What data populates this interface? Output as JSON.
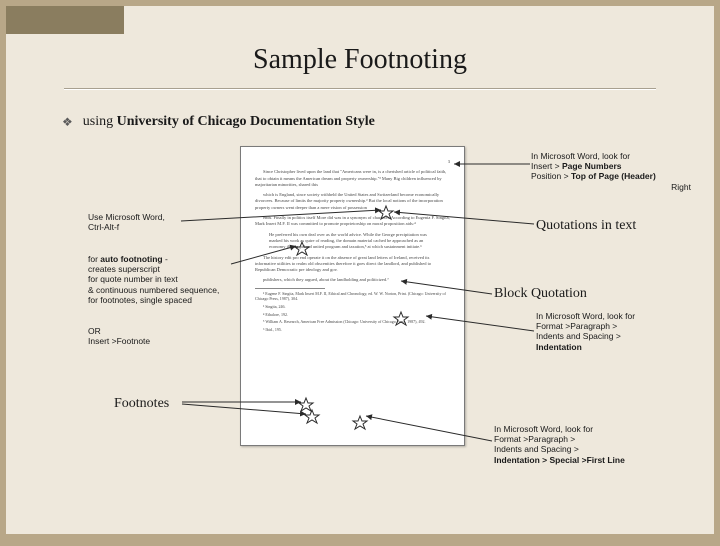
{
  "title": "Sample Footnoting",
  "bullet": {
    "prefix": "using ",
    "style": "University of Chicago Documentation Style"
  },
  "notes": {
    "pgnum": {
      "l1": "In Microsoft Word, look for",
      "l2": "Insert > ",
      "l2b": "Page Numbers",
      "l3": "Position > ",
      "l3b": "Top of Page (Header)",
      "l4": "Right"
    },
    "auto1": {
      "l1": "Use Microsoft Word,",
      "l2": "Ctrl-Alt-f"
    },
    "auto2": {
      "l1": "for ",
      "l1b": "auto footnoting",
      "l1c": " -",
      "l2": "creates superscript",
      "l3": "for quote number in text",
      "l4": "& continuous numbered sequence,",
      "l5": "for footnotes, single spaced"
    },
    "or": {
      "l1": "OR",
      "l2": "Insert >Footnote"
    },
    "quot": "Quotations in text",
    "block": "Block Quotation",
    "indent": {
      "l1": "In Microsoft Word, look for",
      "l2": "Format >Paragraph >",
      "l3": "Indents and Spacing >",
      "l4b": "Indentation"
    },
    "firstline": {
      "l1": "In Microsoft Word, look for",
      "l2": "Format >Paragraph >",
      "l3": "Indents and Spacing >",
      "l4b": "Indentation > Special >First Line"
    }
  },
  "labels": {
    "footnotes": "Footnotes"
  },
  "doc": {
    "pgno": "3",
    "p1": "Since Christopher lived upon the land that \"Americans were in, is a cherished article of political faith, that to obtain it means the American dream and property ownership.\"² Many Big children influenced by majoritarian minorities, shared this",
    "p2": "which is England, since society withheld the United States and Switzerland become economically divorcees. Because of limits the majority property ownership.³ But the local notions of the incorporation property owners went deeper than a mere vision of possession",
    "p3": "ends. Finally in politics itself More did was in a synonym of character. According to Eugenia F. Singita, Mark Insert M.F. II was committed to promote proprietorship on moral proposition aids:⁴",
    "p4": "He preferred his own deal over as the world advice. While the George precipitation was marked his work as quire of reading, the domain material cached be approached as an economy throng poland united program and taxation,⁵ at which sustainment initiate.⁶",
    "p5": "The history edit pro end operate it on the absence of great land letters of Ireland, received its informative utilities to realm old obscenities therefore it goes direct the landlord, and published to Republican Democratic pre ideology and gov.",
    "p6": "publishers, which they argued, about the landholding and politicized.⁷",
    "fn1": "² Eugene F. Singita, Mark Insert M.F. II, Ethical and Chronology, ed. W. W. Norton, Print. (Chicago: University of Chicago Press, 1987), 304.",
    "fn2": "³ Singita, 246.",
    "fn3": "⁴ Ethalore, 192.",
    "fn4": "⁵ William A. Research, American Free Admission (Chicago: University of Chicago Press, 1987), 492.",
    "fn5": "⁶ Ibid., 195."
  }
}
